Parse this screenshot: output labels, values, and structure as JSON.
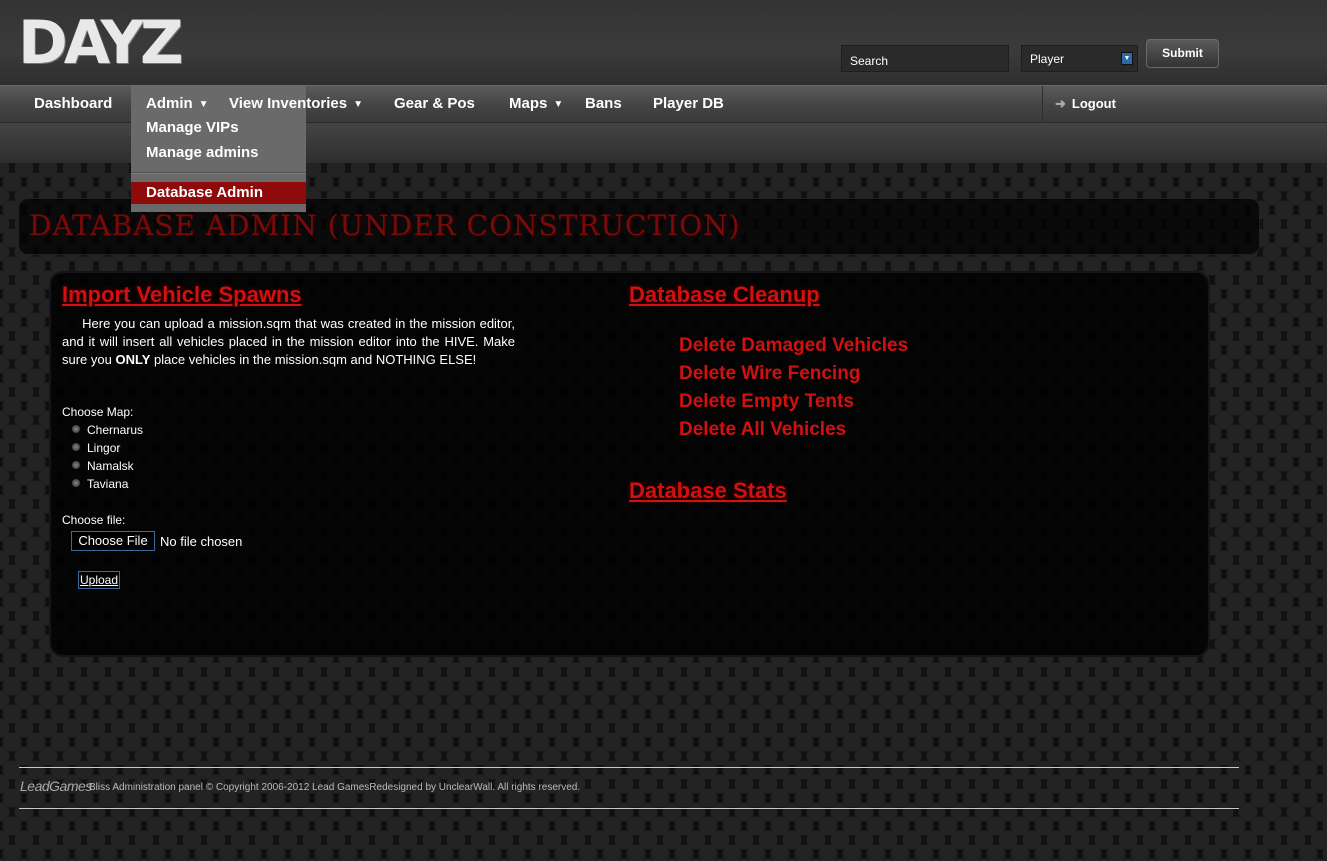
{
  "header": {
    "logo_text": "DAYZ",
    "search_placeholder": "Search",
    "player_select": "Player",
    "submit_label": "Submit"
  },
  "nav": {
    "items": [
      {
        "label": "Dashboard"
      },
      {
        "label": "Admin"
      },
      {
        "label": "View Inventories"
      },
      {
        "label": "Gear & Pos"
      },
      {
        "label": "Maps"
      },
      {
        "label": "Bans"
      },
      {
        "label": "Player DB"
      }
    ],
    "logout": "Logout"
  },
  "dropdown": {
    "items": [
      "Manage VIPs",
      "Manage admins",
      "Database Admin"
    ]
  },
  "page": {
    "title": "Database Admin (Under Construction)"
  },
  "import": {
    "title": "Import Vehicle Spawns",
    "desc_1": "Here you can upload a mission.sqm that was created in the mission editor, and it will insert all vehicles placed in the mission editor into the HIVE. Make sure you ",
    "desc_bold": "ONLY",
    "desc_2": " place vehicles in the mission.sqm and NOTHING ELSE!",
    "choose_map_label": "Choose Map:",
    "maps": [
      "Chernarus",
      "Lingor",
      "Namalsk",
      "Taviana"
    ],
    "choose_file_label": "Choose file:",
    "choose_file_button": "Choose File",
    "no_file": "No file chosen",
    "upload_button": "Upload"
  },
  "cleanup": {
    "title": "Database Cleanup",
    "links": [
      "Delete Damaged Vehicles",
      "Delete Wire Fencing",
      "Delete Empty Tents",
      "Delete All Vehicles"
    ]
  },
  "stats": {
    "title": "Database Stats"
  },
  "footer": {
    "logo": "LeadGames",
    "text": "Bliss Administration panel © Copyright 2006-2012 Lead GamesRedesigned by UnclearWall. All rights reserved."
  },
  "colors": {
    "accent_red": "#d21010",
    "menu_active": "#8f0a0a"
  }
}
